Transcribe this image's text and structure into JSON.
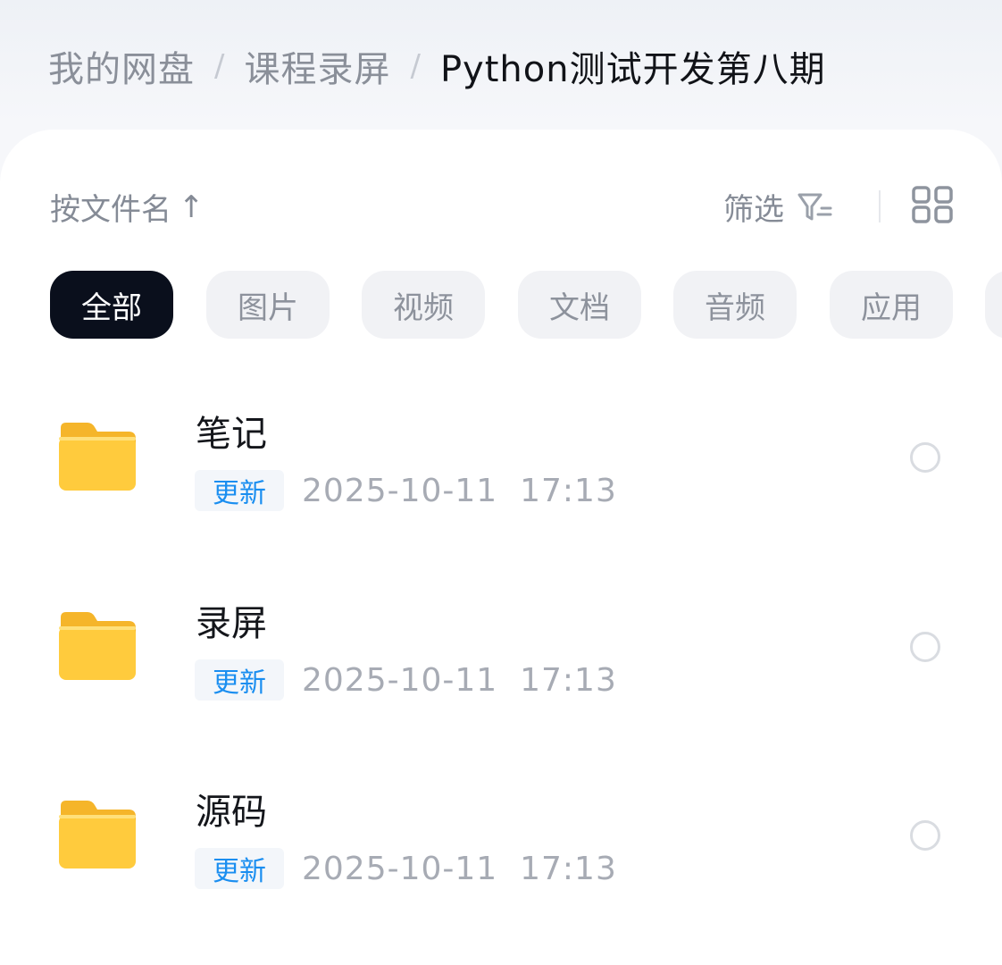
{
  "breadcrumb": {
    "items": [
      "我的网盘",
      "课程录屏",
      "Python测试开发第八期"
    ],
    "separator": "/"
  },
  "toolbar": {
    "sort_label": "按文件名",
    "sort_arrow": "↑",
    "filter_label": "筛选",
    "filter_icon": "filter-icon",
    "view_icon": "grid-view-icon"
  },
  "tabs": [
    {
      "label": "全部",
      "active": true
    },
    {
      "label": "图片",
      "active": false
    },
    {
      "label": "视频",
      "active": false
    },
    {
      "label": "文档",
      "active": false
    },
    {
      "label": "音频",
      "active": false
    },
    {
      "label": "应用",
      "active": false
    },
    {
      "label": "",
      "active": false
    }
  ],
  "files": [
    {
      "name": "笔记",
      "badge": "更新",
      "time": "2025-10-11  17:13",
      "icon": "folder-icon"
    },
    {
      "name": "录屏",
      "badge": "更新",
      "time": "2025-10-11  17:13",
      "icon": "folder-icon"
    },
    {
      "name": "源码",
      "badge": "更新",
      "time": "2025-10-11  17:13",
      "icon": "folder-icon"
    }
  ],
  "colors": {
    "active_tab_bg": "#0a0f1c",
    "badge_text": "#1a8ef0",
    "folder_yellow": "#ffc93b"
  }
}
